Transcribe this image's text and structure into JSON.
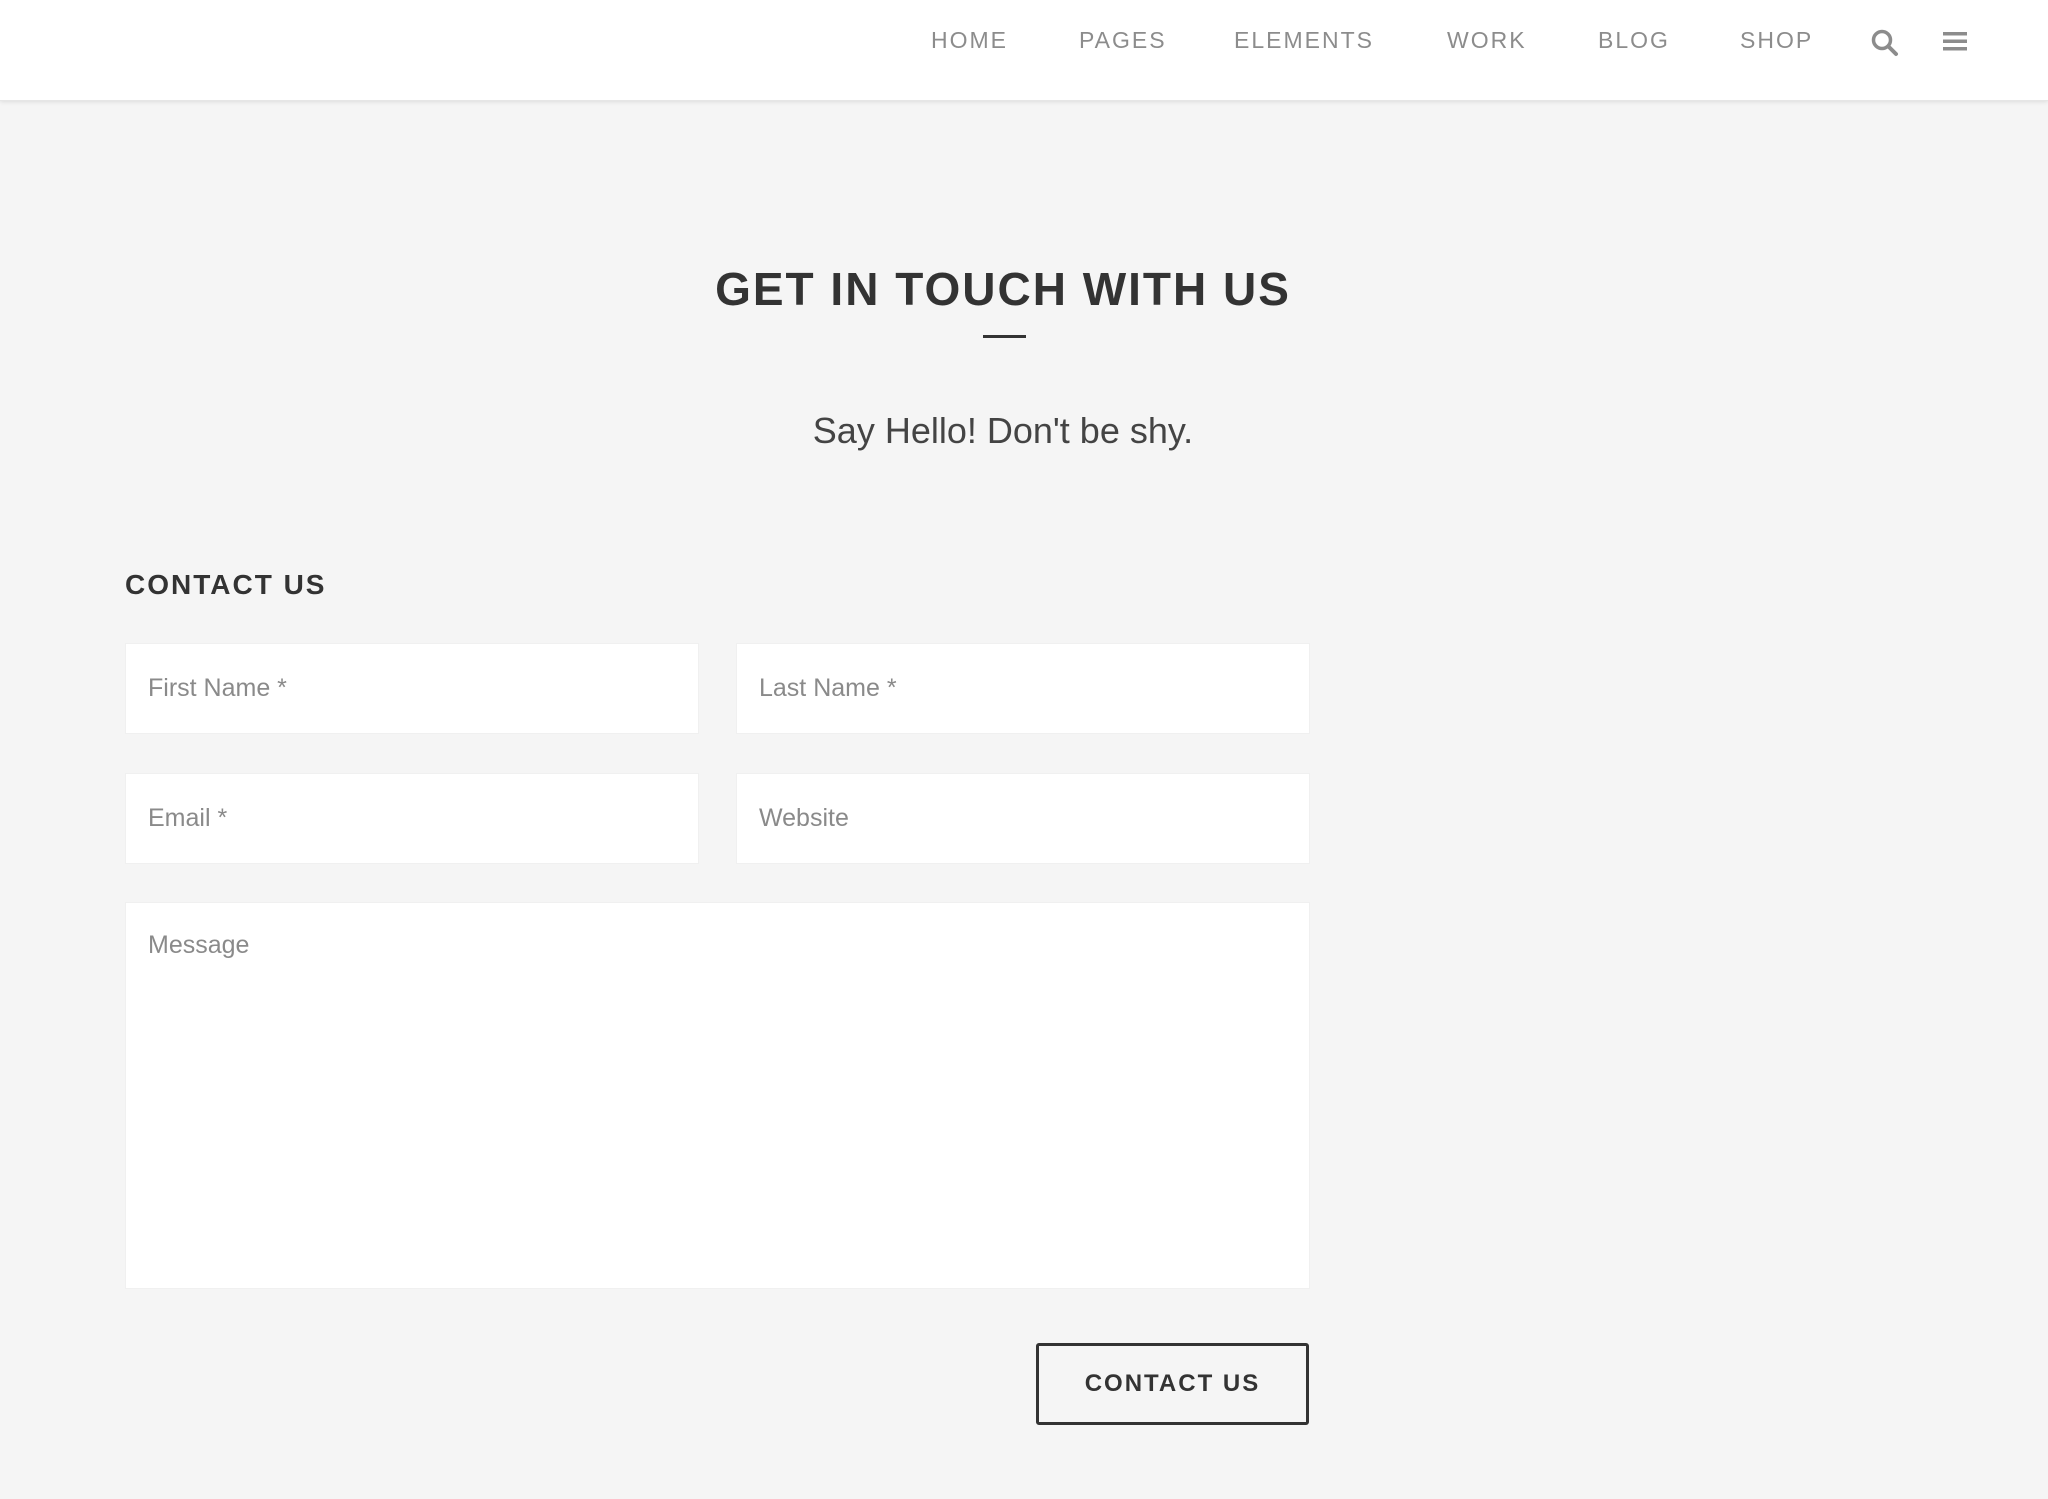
{
  "nav": {
    "items": [
      "HOME",
      "PAGES",
      "ELEMENTS",
      "WORK",
      "BLOG",
      "SHOP"
    ],
    "search_icon": "search-icon",
    "menu_icon": "hamburger-menu-icon"
  },
  "main": {
    "title": "GET IN TOUCH WITH US",
    "subtitle": "Say Hello! Don't be shy."
  },
  "form": {
    "heading": "CONTACT US",
    "first_name": {
      "placeholder": "First Name *",
      "value": ""
    },
    "last_name": {
      "placeholder": "Last Name *",
      "value": ""
    },
    "email": {
      "placeholder": "Email *",
      "value": ""
    },
    "website": {
      "placeholder": "Website",
      "value": ""
    },
    "message": {
      "placeholder": "Message",
      "value": ""
    },
    "submit_label": "CONTACT US"
  },
  "colors": {
    "background": "#f5f5f5",
    "header": "#ffffff",
    "nav_text": "#8c8c8c",
    "heading_text": "#333333",
    "field_background": "#ffffff",
    "button_border": "#333333"
  }
}
